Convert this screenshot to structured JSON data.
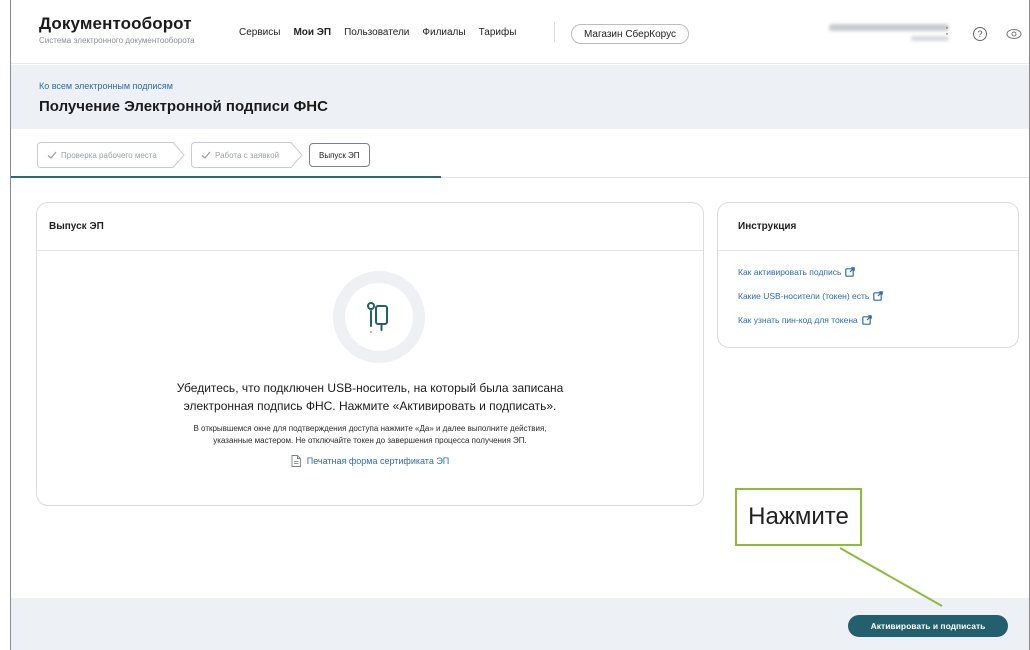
{
  "header": {
    "brand_title": "Документооборот",
    "brand_subtitle": "Система электронного документооборота",
    "nav": [
      "Сервисы",
      "Мои ЭП",
      "Пользователи",
      "Филиалы",
      "Тарифы"
    ],
    "nav_active": "Мои ЭП",
    "shop_button": "Магазин СберКорус"
  },
  "title_band": {
    "back_link": "Ко всем электронным подписям",
    "title": "Получение Электронной подписи ФНС"
  },
  "stepper": {
    "steps": [
      "Проверка рабочего места",
      "Работа с заявкой",
      "Выпуск ЭП"
    ],
    "current_index": 2
  },
  "main_card": {
    "title": "Выпуск ЭП",
    "message_line1": "Убедитесь, что подключен USB-носитель, на который была записана",
    "message_line2": "электронная подпись ФНС. Нажмите «Активировать и подписать».",
    "sub_line1": "В открывшемся окне для подтверждения доступа нажмите «Да» и далее выполните действия,",
    "sub_line2": "указанные мастером. Не отключайте токен до завершения процесса получения ЭП.",
    "cert_link": "Печатная форма сертификата ЭП"
  },
  "instructions": {
    "title": "Инструкция",
    "links": [
      "Как активировать подпись",
      "Какие USB-носители (токен) есть",
      "Как узнать пин-код для токена"
    ]
  },
  "footer": {
    "activate_button": "Активировать и подписать"
  },
  "annotation": {
    "callout_text": "Нажмите"
  },
  "colors": {
    "accent": "#235f6d",
    "link": "#2b6cb0",
    "band": "#edf0f4",
    "callout_border": "#8dbb3c"
  },
  "icons": [
    "help-icon",
    "eye-icon",
    "check-icon",
    "usb-token-icon",
    "document-icon",
    "external-link-icon"
  ]
}
